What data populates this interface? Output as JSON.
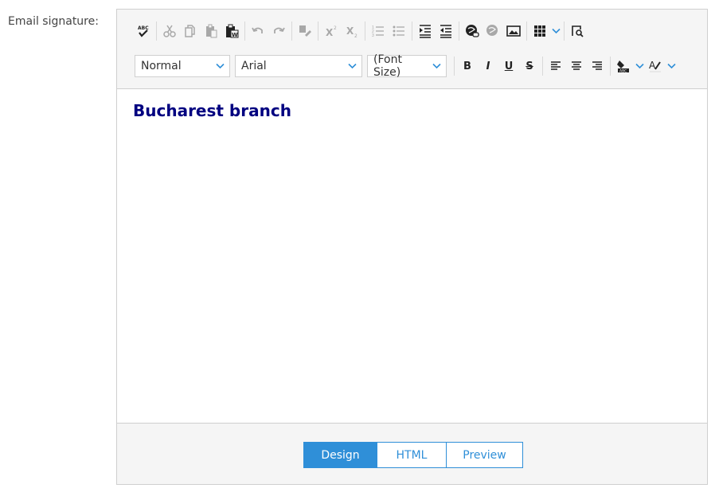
{
  "field_label": "Email signature:",
  "toolbar": {
    "row1": [
      {
        "icon": "spell-check-icon",
        "enabled": true
      },
      {
        "icon": "cut-icon",
        "enabled": false
      },
      {
        "icon": "copy-icon",
        "enabled": false
      },
      {
        "icon": "paste-icon",
        "enabled": false
      },
      {
        "icon": "paste-from-word-icon",
        "enabled": true
      },
      {
        "icon": "undo-icon",
        "enabled": false
      },
      {
        "icon": "redo-icon",
        "enabled": false
      },
      {
        "icon": "format-stripper-icon",
        "enabled": false
      },
      {
        "icon": "superscript-icon",
        "enabled": false
      },
      {
        "icon": "subscript-icon",
        "enabled": false
      },
      {
        "icon": "ordered-list-icon",
        "enabled": false
      },
      {
        "icon": "unordered-list-icon",
        "enabled": false
      },
      {
        "icon": "indent-icon",
        "enabled": true
      },
      {
        "icon": "outdent-icon",
        "enabled": true
      },
      {
        "icon": "insert-link-icon",
        "enabled": true
      },
      {
        "icon": "remove-link-icon",
        "enabled": false
      },
      {
        "icon": "insert-image-icon",
        "enabled": true
      },
      {
        "icon": "insert-table-icon",
        "enabled": true
      },
      {
        "icon": "find-icon",
        "enabled": true
      }
    ],
    "paragraph_style": "Normal",
    "font_name": "Arial",
    "font_size": "(Font Size)",
    "bold": "B",
    "italic": "I",
    "underline": "U",
    "strike": "S"
  },
  "content": {
    "heading": "Bucharest branch",
    "heading_color": "#000080"
  },
  "modes": [
    {
      "label": "Design",
      "active": true
    },
    {
      "label": "HTML",
      "active": false
    },
    {
      "label": "Preview",
      "active": false
    }
  ],
  "colors": {
    "accent": "#2f8fd8",
    "toolbar_bg": "#f5f5f5",
    "border": "#cfcfcf"
  }
}
